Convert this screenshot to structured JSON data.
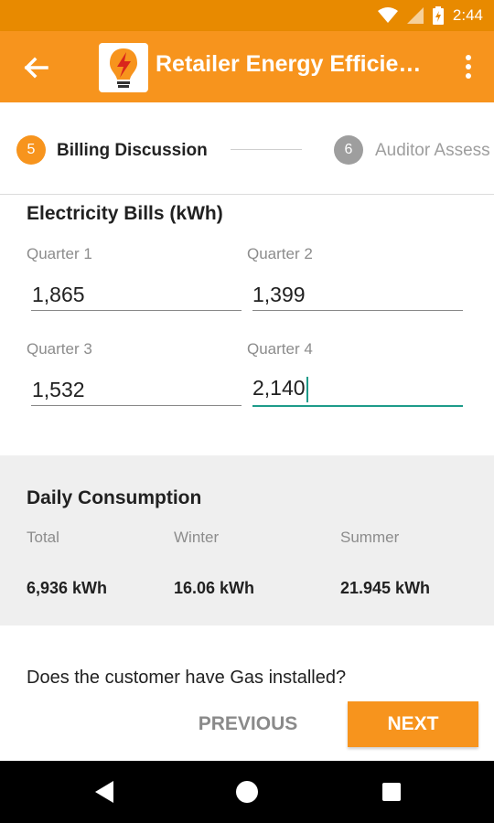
{
  "status_bar": {
    "time": "2:44",
    "icons": [
      "wifi-icon",
      "signal-icon",
      "battery-icon"
    ]
  },
  "app_bar": {
    "title": "Retailer Energy Efficie…",
    "back_icon": "arrow-back-icon",
    "logo_icon": "lightbulb-logo-icon",
    "menu_icon": "more-vert-icon"
  },
  "stepper": {
    "steps": [
      {
        "number": "5",
        "label": "Billing Discussion",
        "active": true
      },
      {
        "number": "6",
        "label": "Auditor Assess",
        "active": false
      }
    ]
  },
  "electricity": {
    "title": "Electricity Bills (kWh)",
    "fields": [
      {
        "label": "Quarter 1",
        "value": "1,865"
      },
      {
        "label": "Quarter 2",
        "value": "1,399"
      },
      {
        "label": "Quarter 3",
        "value": "1,532"
      },
      {
        "label": "Quarter 4",
        "value": "2,140"
      }
    ]
  },
  "daily": {
    "title": "Daily Consumption",
    "columns": [
      {
        "label": "Total",
        "value": "6,936 kWh"
      },
      {
        "label": "Winter",
        "value": "16.06 kWh"
      },
      {
        "label": "Summer",
        "value": "21.945 kWh"
      }
    ]
  },
  "question": "Does the customer have Gas installed?",
  "buttons": {
    "previous": "PREVIOUS",
    "next": "NEXT"
  },
  "colors": {
    "accent": "#f7941d",
    "status_bar": "#e88a00",
    "focus": "#1e9b8a",
    "inactive": "#9e9e9e"
  },
  "nav_bar": {
    "icons": [
      "back-triangle-icon",
      "home-circle-icon",
      "recents-square-icon"
    ]
  }
}
